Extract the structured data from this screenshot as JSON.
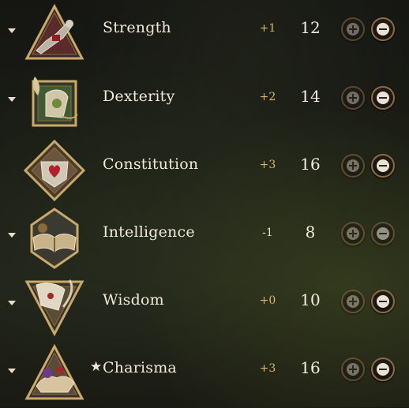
{
  "abilities": [
    {
      "label": "Strength",
      "modifier": "+1",
      "score": "12",
      "star": "",
      "expand": true,
      "icon": "arm-gauntlet-icon",
      "plus_enabled": false
    },
    {
      "label": "Dexterity",
      "modifier": "+2",
      "score": "14",
      "star": "",
      "expand": true,
      "icon": "feathered-scroll-icon",
      "plus_enabled": false
    },
    {
      "label": "Constitution",
      "modifier": "+3",
      "score": "16",
      "star": "",
      "expand": false,
      "icon": "heart-shield-icon",
      "plus_enabled": false
    },
    {
      "label": "Intelligence",
      "modifier": "-1",
      "score": "8",
      "star": "",
      "expand": true,
      "icon": "open-book-icon",
      "plus_enabled": false
    },
    {
      "label": "Wisdom",
      "modifier": "+0",
      "score": "10",
      "star": "",
      "expand": true,
      "icon": "quill-parchment-icon",
      "plus_enabled": false
    },
    {
      "label": "Charisma",
      "modifier": "+3",
      "score": "16",
      "star": "★",
      "expand": true,
      "icon": "handshake-icon",
      "plus_enabled": false
    }
  ],
  "colors": {
    "label": "#f1e9d8",
    "positive_modifier": "#d9b96a",
    "button_rim": "#8c6c45",
    "emblem_gold": "#c9a86a"
  }
}
